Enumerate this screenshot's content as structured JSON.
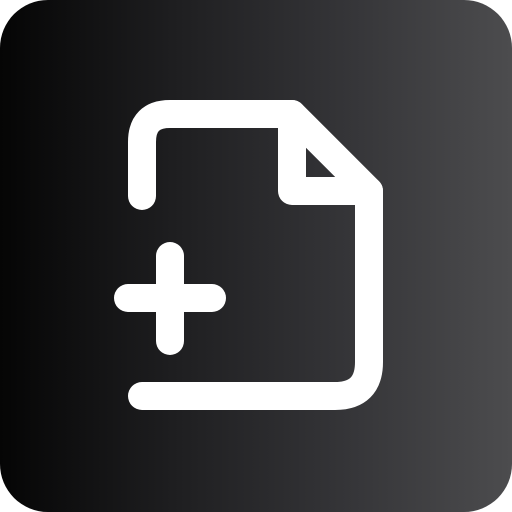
{
  "icon": {
    "name": "new-file-icon",
    "glyph_name": "file-plus-icon",
    "background_colors": [
      "#050505",
      "#1f1f21",
      "#333336",
      "#4c4c4e"
    ],
    "stroke_color": "#ffffff"
  }
}
